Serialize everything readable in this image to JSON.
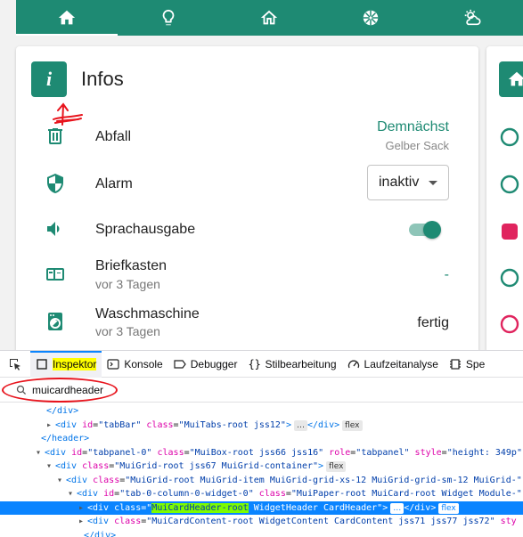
{
  "colors": {
    "primary": "#1e8a73",
    "annotation_red": "#e8141d",
    "devtools_selection": "#0a84ff"
  },
  "tabbar": {
    "tabs": [
      "home-icon",
      "lightbulb-icon",
      "house-outline-icon",
      "aperture-icon",
      "weather-icon"
    ],
    "active_index": 0
  },
  "card": {
    "avatar_letter": "i",
    "title": "Infos",
    "rows": [
      {
        "icon": "trash-icon",
        "label": "Abfall",
        "value": "Demnächst",
        "value_sub": "Gelber Sack"
      },
      {
        "icon": "shield-icon",
        "label": "Alarm",
        "select_value": "inaktiv"
      },
      {
        "icon": "speaker-icon",
        "label": "Sprachausgabe",
        "switch_on": true
      },
      {
        "icon": "mailbox-icon",
        "label": "Briefkasten",
        "sub": "vor 3 Tagen",
        "value": "-"
      },
      {
        "icon": "washing-machine-icon",
        "label": "Waschmaschine",
        "sub": "vor 3 Tagen",
        "value": "fertig"
      }
    ]
  },
  "devtools": {
    "tabs": [
      {
        "icon": "inspector-icon",
        "label": "Inspektor",
        "active": true
      },
      {
        "icon": "console-icon",
        "label": "Konsole"
      },
      {
        "icon": "debugger-icon",
        "label": "Debugger"
      },
      {
        "icon": "braces-icon",
        "label": "Stilbearbeitung"
      },
      {
        "icon": "gauge-icon",
        "label": "Laufzeitanalyse"
      },
      {
        "icon": "memory-icon",
        "label": "Spe"
      }
    ],
    "search_value": "muicardheader",
    "dom_lines": [
      {
        "indent": 52,
        "text": "</div>"
      },
      {
        "indent": 52,
        "toggle": "▸",
        "tag": "div",
        "attrs": [
          [
            "id",
            "tabBar"
          ],
          [
            "class",
            "MuiTabs-root jss12"
          ]
        ],
        "inner": "…",
        "close": "</div>",
        "badge": "flex"
      },
      {
        "indent": 46,
        "text": "</header>"
      },
      {
        "indent": 40,
        "toggle": "▾",
        "tag": "div",
        "attrs": [
          [
            "id",
            "tabpanel-0"
          ],
          [
            "class",
            "MuiBox-root jss66 jss16"
          ],
          [
            "role",
            "tabpanel"
          ],
          [
            "style",
            "height: 349p"
          ]
        ]
      },
      {
        "indent": 52,
        "toggle": "▾",
        "tag": "div",
        "attrs": [
          [
            "class",
            "MuiGrid-root jss67 MuiGrid-container"
          ]
        ],
        "badge": "flex"
      },
      {
        "indent": 64,
        "toggle": "▾",
        "tag": "div",
        "attrs": [
          [
            "class",
            "MuiGrid-root MuiGrid-item MuiGrid-grid-xs-12 MuiGrid-grid-sm-12 MuiGrid-"
          ]
        ]
      },
      {
        "indent": 76,
        "toggle": "▾",
        "tag": "div",
        "attrs": [
          [
            "id",
            "tab-0-column-0-widget-0"
          ],
          [
            "class",
            "MuiPaper-root MuiCard-root Widget Module-"
          ]
        ]
      },
      {
        "indent": 88,
        "toggle": "▸",
        "tag": "div",
        "selected": true,
        "attrs": [
          [
            "class",
            "MuiCardHeader-root WidgetHeader CardHeader"
          ]
        ],
        "highlight": "MuiCardHeader-root",
        "inner": "…",
        "close": "</div>",
        "badge": "flex"
      },
      {
        "indent": 88,
        "toggle": "▸",
        "tag": "div",
        "attrs": [
          [
            "class",
            "MuiCardContent-root WidgetContent CardContent jss71 jss77 jss72"
          ],
          [
            "sty",
            ""
          ]
        ]
      },
      {
        "indent": 94,
        "text": "</div>"
      }
    ]
  }
}
